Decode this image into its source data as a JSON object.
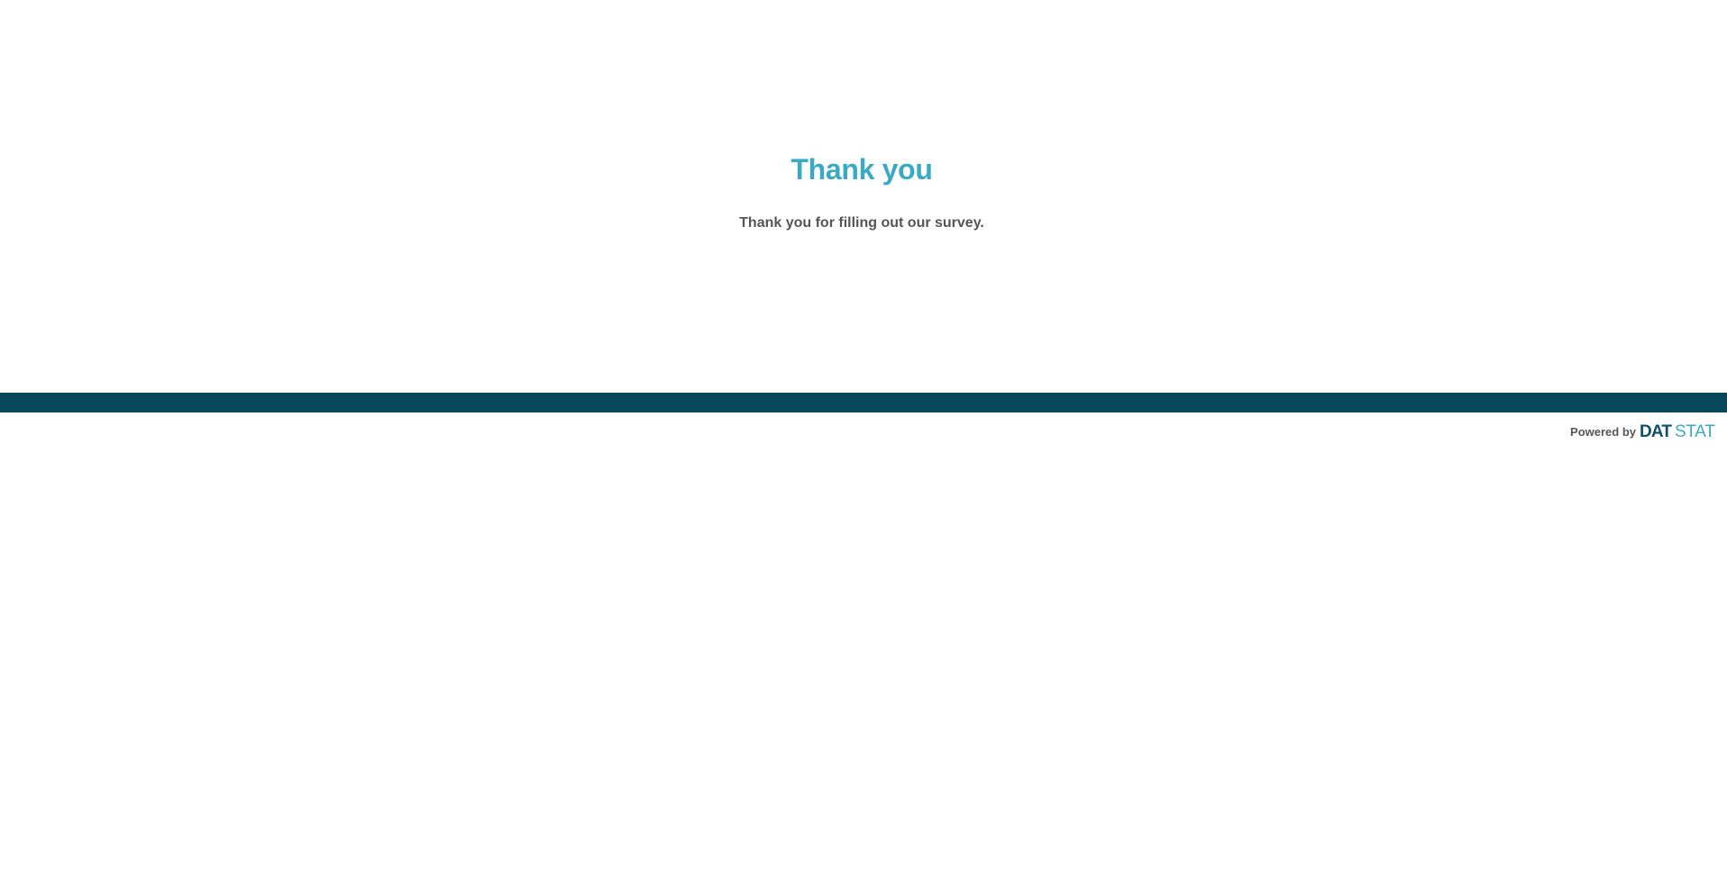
{
  "main": {
    "title": "Thank you",
    "message": "Thank you for filling out our survey."
  },
  "footer": {
    "powered_by_label": "Powered by",
    "logo": {
      "text_dark": "DAT",
      "text_light": "STAT"
    }
  },
  "colors": {
    "title": "#3aaac4",
    "body_text": "#555555",
    "footer_bar": "#07475a",
    "logo_dark": "#0d4f6c",
    "logo_light": "#3aaac4"
  }
}
